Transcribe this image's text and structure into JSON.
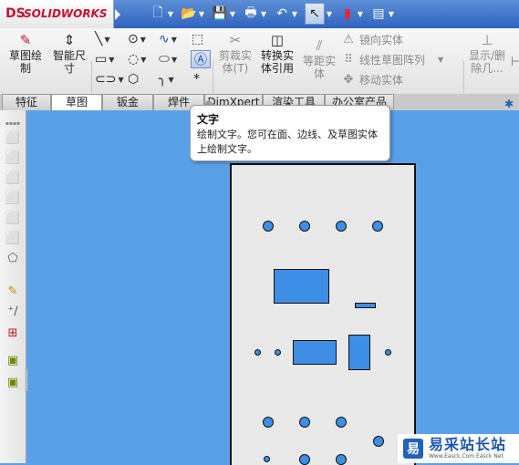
{
  "app": {
    "logo_mark": "DS",
    "brand": "SOLIDWORKS"
  },
  "toolbar": {
    "buttons": [
      {
        "icon": "new-document-icon",
        "glyph": "🗋"
      },
      {
        "icon": "open-folder-icon",
        "glyph": "📂"
      },
      {
        "icon": "save-icon",
        "glyph": "💾"
      },
      {
        "icon": "print-icon",
        "glyph": "🖶"
      },
      {
        "icon": "undo-icon",
        "glyph": "↶"
      },
      {
        "icon": "select-cursor-icon",
        "glyph": "↖"
      },
      {
        "icon": "traffic-light-icon",
        "glyph": "▮"
      },
      {
        "icon": "options-icon",
        "glyph": "▤"
      }
    ]
  },
  "ribbon": {
    "sketch": "草图绘\n制",
    "smart_dimension": "智能尺\n寸",
    "trim": "剪裁实\n体(T)",
    "convert": "转换实\n体引用",
    "offset": "等距实\n体",
    "mirror": "镜向实体",
    "linear_pattern": "线性草图阵列",
    "move": "移动实体",
    "show_hide": "显示/删\n除几..."
  },
  "tabs": [
    "特征",
    "草图",
    "钣金",
    "焊件",
    "DimXpert",
    "渲染工具",
    "办公室产品"
  ],
  "active_tab": "草图",
  "tooltip": {
    "title": "文字",
    "body": "绘制文字。您可在面、边线、及草图实体上绘制文字。"
  },
  "watermark": {
    "logo": "易",
    "name": "易采站长站",
    "sub": "Www.Easck.Com  Easck Net"
  },
  "colors": {
    "canvas": "#5aa0e8",
    "plate": "#e9e9e9",
    "cutout": "#3f8ee5",
    "brand": "#c8102e"
  }
}
